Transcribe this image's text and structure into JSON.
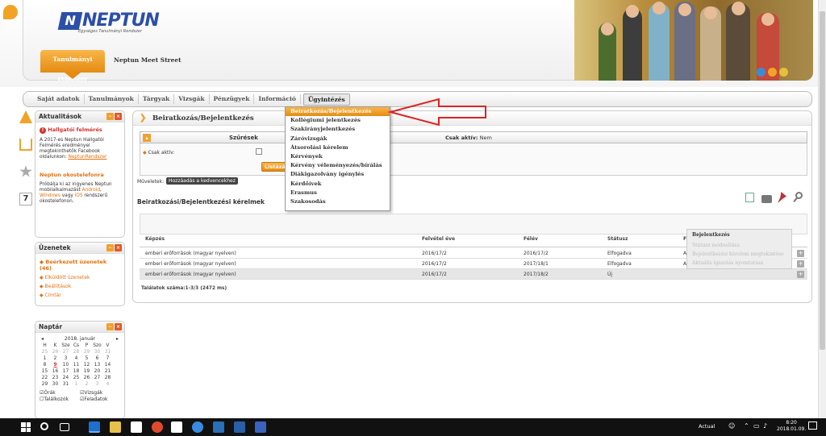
{
  "header": {
    "logo_mark": "N",
    "logo_text": "NEPTUN",
    "logo_subtitle": "Egységes Tanulmányi Rendszer",
    "home_tab": "Tanulmányi rendszer",
    "meet_street": "Neptun Meet Street"
  },
  "mainnav": {
    "items": [
      "Saját adatok",
      "Tanulmányok",
      "Tárgyak",
      "Vizsgák",
      "Pénzügyek",
      "Információ",
      "Ügyintézés"
    ],
    "active": "Ügyintézés"
  },
  "dropdown": {
    "items": [
      "Beiratkozás/Bejelentkezés",
      "Kollégiumi jelentkezés",
      "Szakirányjelentkezés",
      "Záróvizsgák",
      "Átsorolási kérelem",
      "Kérvények",
      "Kérvény véleményezés/bírálás",
      "Diákigazolvány igénylés",
      "Kérdőívek",
      "Erasmus",
      "Szakosodás"
    ],
    "selected": "Beiratkozás/Bejelentkezés"
  },
  "aktualitasok": {
    "title": "Aktualitások",
    "news1_title": "Hallgatói felmérés",
    "news1_text": "A 2017-es Neptun Hallgatói Felmérés eredményei megtekinthetők Facebook oldalunkon:",
    "news1_link": "NeptunRendszer",
    "news2_title": "Neptun okostelefonra",
    "news2_text_a": "Próbálja ki az ingyenes Neptun mobilalkalmazást",
    "news2_android": "Android",
    "news2_windows": "Windows",
    "news2_vagy": "vagy",
    "news2_ios": "iOS",
    "news2_text_b": "rendszerű okostelefonon."
  },
  "uzenetek": {
    "title": "Üzenetek",
    "items": [
      "Beérkezett üzenetek (46)",
      "Elküldött üzenetek",
      "Beállítások",
      "Címtár"
    ]
  },
  "naptar": {
    "title": "Naptár",
    "month": "2018. január",
    "prev": "◂",
    "next": "▸",
    "weekdays": [
      "H",
      "K",
      "Sze",
      "Cs",
      "P",
      "Szo",
      "V"
    ],
    "weeks": [
      [
        "25",
        "26",
        "27",
        "28",
        "29",
        "30",
        "31"
      ],
      [
        "1",
        "2",
        "3",
        "4",
        "5",
        "6",
        "7"
      ],
      [
        "8",
        "9",
        "10",
        "11",
        "12",
        "13",
        "14"
      ],
      [
        "15",
        "16",
        "17",
        "18",
        "19",
        "20",
        "21"
      ],
      [
        "22",
        "23",
        "24",
        "25",
        "26",
        "27",
        "28"
      ],
      [
        "29",
        "30",
        "31",
        "1",
        "2",
        "3",
        "4"
      ]
    ],
    "checks": [
      "Órák",
      "Vizsgák",
      "Találkozók",
      "Feladatok"
    ]
  },
  "content": {
    "title": "Beiratkozás/Bejelentkezés",
    "filter_title": "Szűrések",
    "filter_status_label": "Csak aktív:",
    "filter_status_value": "Nem",
    "filter_checkbox_label": "Csak aktív:",
    "list_button": "Listázás",
    "muveletek_label": "Műveletek:",
    "fav_button": "Hozzáadás a kedvencekhez",
    "list_title": "Beiratkozási/Bejelentkezési kérelmek",
    "columns": [
      "Képzés",
      "Felvétel éve",
      "Félév",
      "Státusz",
      "F"
    ],
    "rows": [
      [
        "emberi erőforrások (magyar nyelven)",
        "2016/17/2",
        "2016/17/2",
        "Elfogadva",
        "A"
      ],
      [
        "emberi erőforrások (magyar nyelven)",
        "2016/17/2",
        "2017/18/1",
        "Elfogadva",
        "A"
      ],
      [
        "emberi erőforrások (magyar nyelven)",
        "2016/17/2",
        "2017/18/2",
        "Új",
        ""
      ]
    ],
    "count": "Találatok száma:1-3/3 (2472 ms)"
  },
  "context_menu": {
    "items": [
      "Bejelentkezés",
      "Státusz módosítása",
      "Bejelentkezési kérelem megtekintése",
      "Aktuális igazolás nyomtatása"
    ]
  },
  "taskbar": {
    "lang": "Actual",
    "time": "8:20",
    "date": "2018.01.09."
  }
}
